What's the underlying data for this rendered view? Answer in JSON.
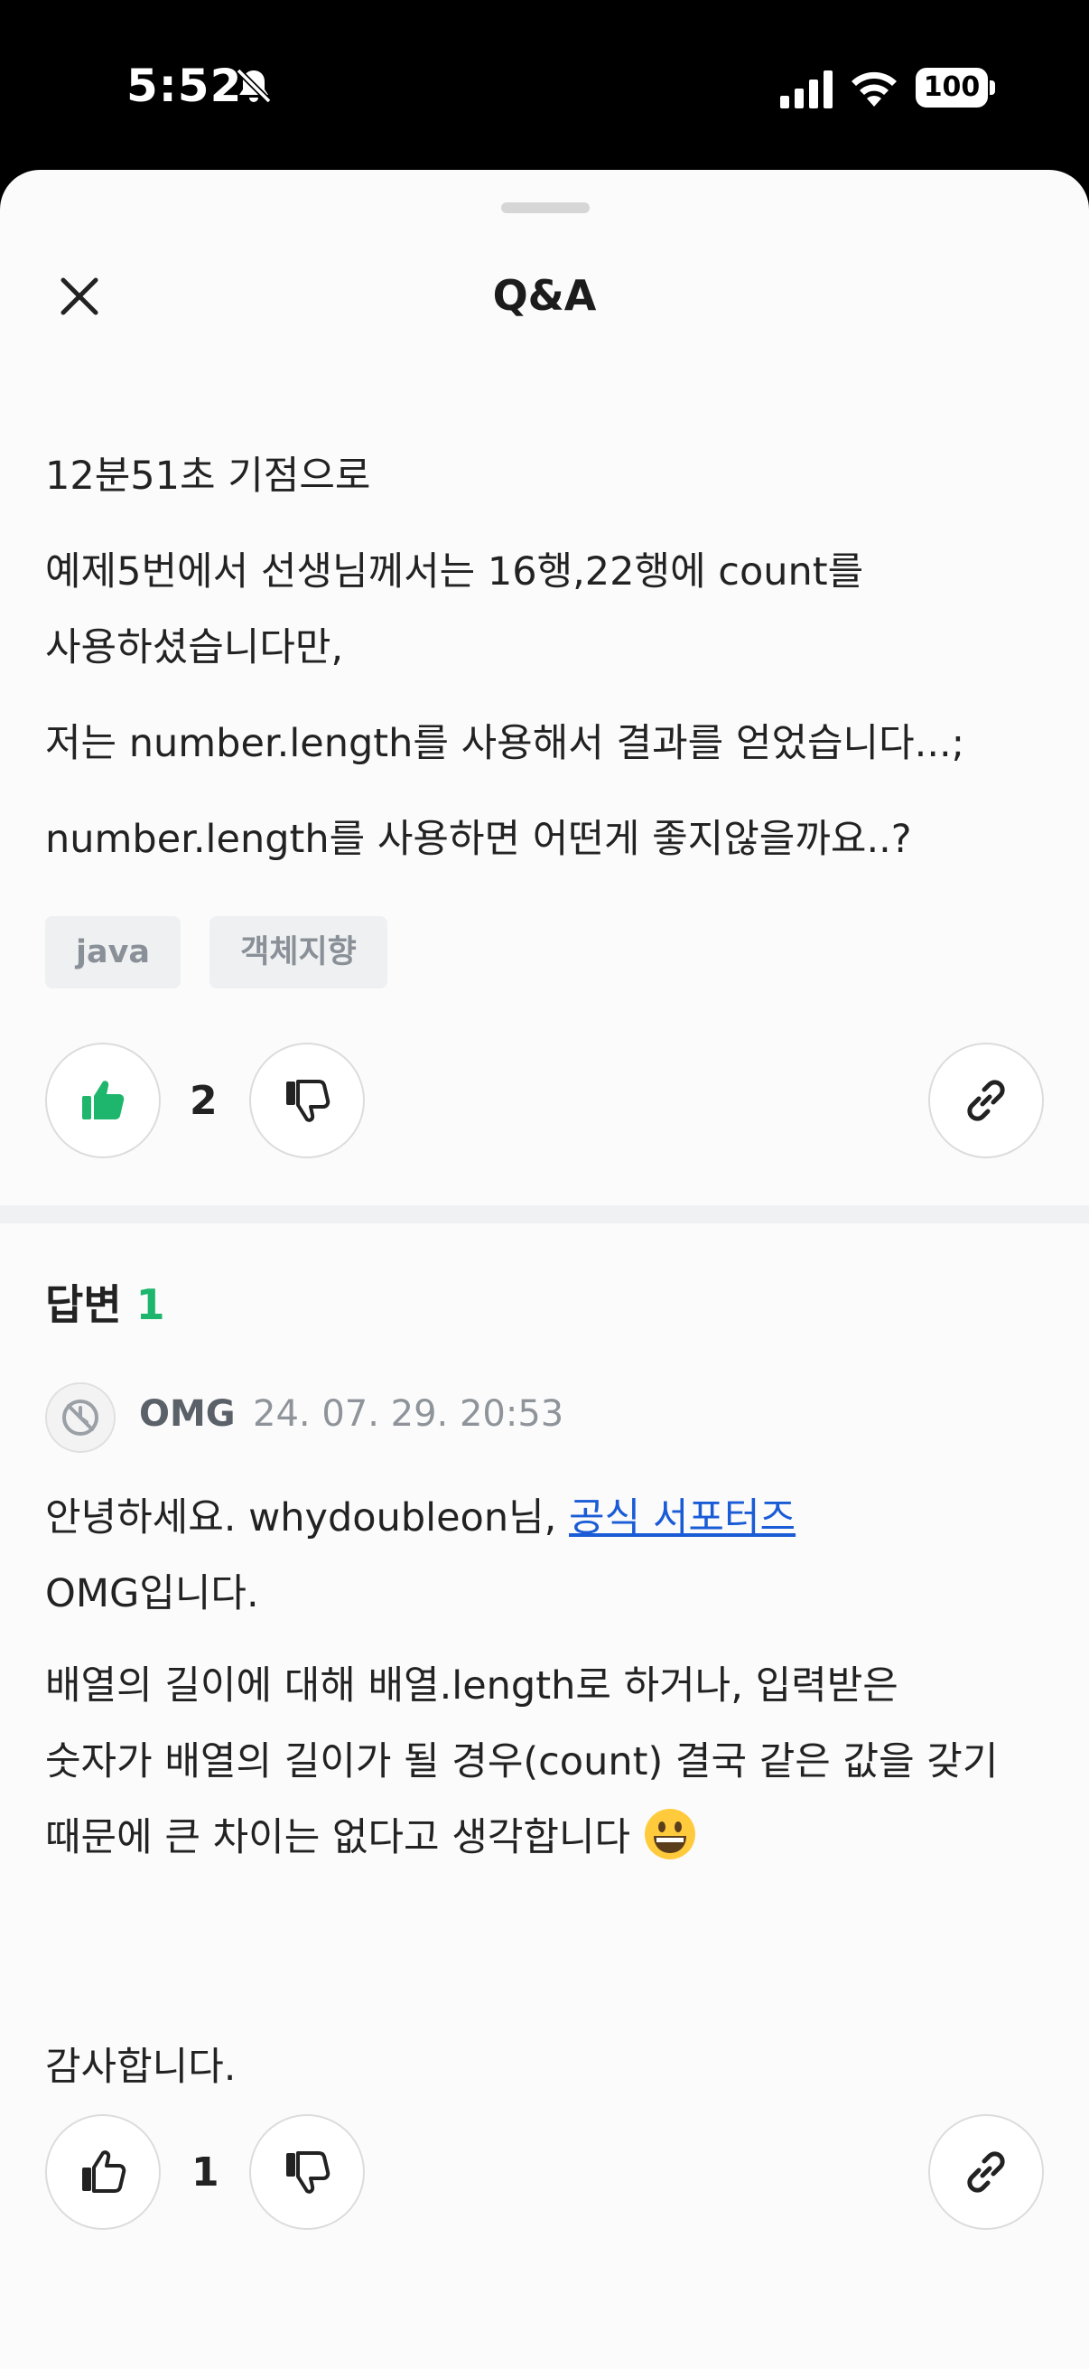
{
  "status_bar": {
    "time": "5:52",
    "battery": "100"
  },
  "sheet": {
    "title": "Q&A"
  },
  "question": {
    "lines": [
      "12분51초 기점으로",
      "예제5번에서 선생님께서는 16행,22행에 count를",
      "사용하셨습니다만,",
      "저는 number.length를 사용해서 결과를 얻었습니다...;",
      "number.length를 사용하면 어떤게 좋지않을까요..?"
    ],
    "tags": [
      "java",
      "객체지향"
    ],
    "vote_count": "2"
  },
  "answers": {
    "heading": "답변",
    "count": "1",
    "items": [
      {
        "author": "OMG",
        "date": "24. 07. 29. 20:53",
        "greeting": "안녕하세요. whydoubleon님,",
        "supporter_link": "공식 서포터즈",
        "intro": "OMG입니다.",
        "body_lines": [
          "배열의 길이에 대해 배열.length로 하거나, 입력받은",
          "숫자가 배열의 길이가 될 경우(count) 결국 같은 값을 갖기",
          "때문에 큰 차이는 없다고 생각합니다"
        ],
        "closing": "감사합니다.",
        "vote_count": "1"
      }
    ]
  },
  "colors": {
    "accent_green": "#1db66c",
    "link_blue": "#1a5bd6"
  }
}
